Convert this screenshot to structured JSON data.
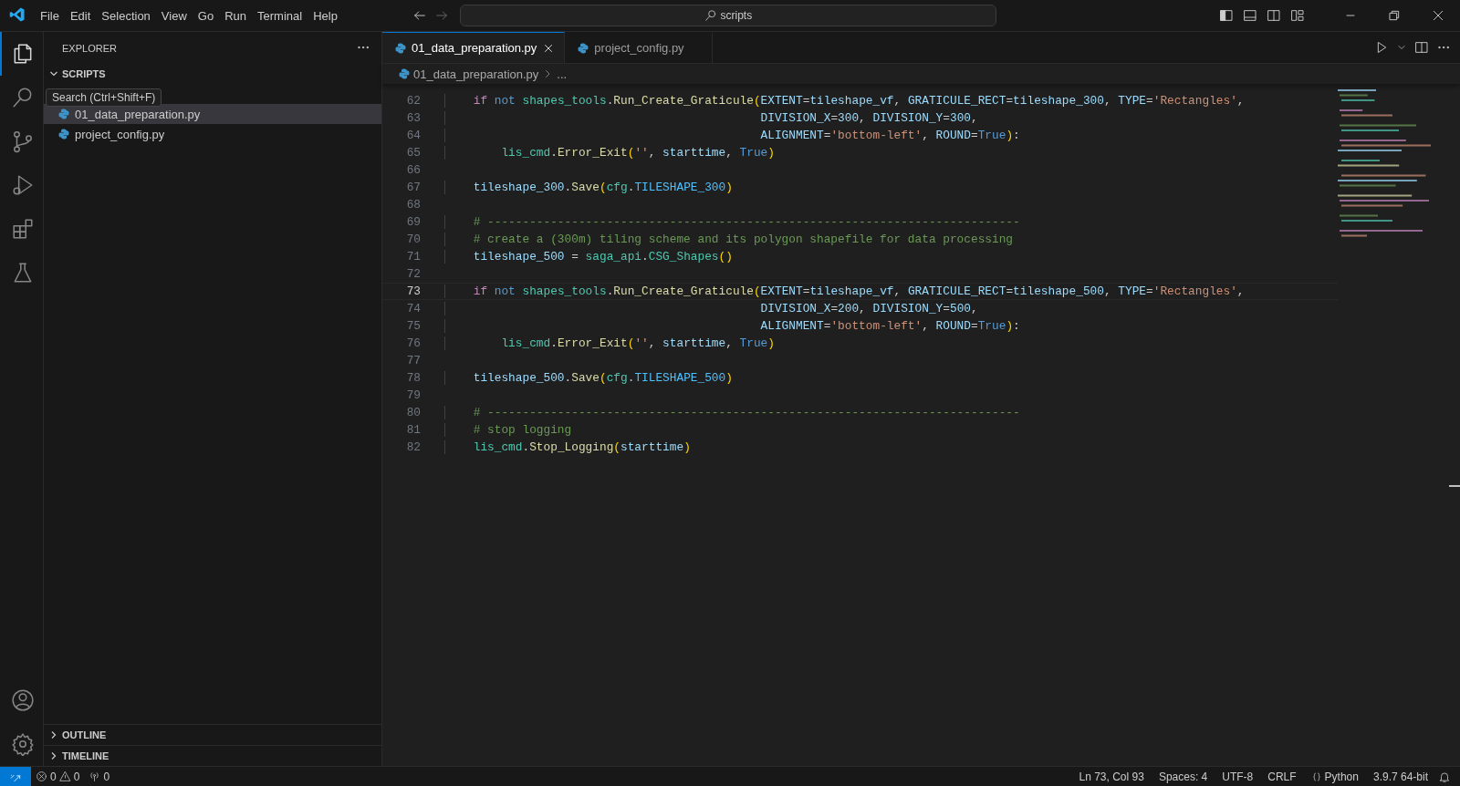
{
  "title_bar": {
    "menus": [
      "File",
      "Edit",
      "Selection",
      "View",
      "Go",
      "Run",
      "Terminal",
      "Help"
    ],
    "search": {
      "value": "scripts"
    }
  },
  "activity_bar": {
    "items": [
      {
        "kind": "files",
        "selected": true
      },
      {
        "kind": "search",
        "selected": false
      },
      {
        "kind": "branch",
        "selected": false
      },
      {
        "kind": "debug",
        "selected": false
      },
      {
        "kind": "extensions",
        "selected": false
      },
      {
        "kind": "flask",
        "selected": false
      }
    ],
    "bottom": [
      {
        "kind": "account"
      },
      {
        "kind": "settings"
      }
    ]
  },
  "sidebar": {
    "title": "EXPLORER",
    "sections": [
      {
        "label": "SCRIPTS",
        "expanded": true,
        "files": [
          {
            "label": "01_data_preparation.py",
            "selected": true
          },
          {
            "label": "project_config.py",
            "selected": false
          }
        ]
      },
      {
        "label": "OUTLINE",
        "expanded": false
      },
      {
        "label": "TIMELINE",
        "expanded": false
      }
    ]
  },
  "tooltip": {
    "text": "Search (Ctrl+Shift+F)"
  },
  "editor": {
    "tabs": [
      {
        "label": "01_data_preparation.py",
        "selected": true
      },
      {
        "label": "project_config.py",
        "selected": false
      }
    ],
    "breadcrumb": [
      "01_data_preparation.py",
      "..."
    ],
    "lines": [
      {
        "number": "62",
        "current": false,
        "tokens": [
          {
            "kind": "kw",
            "text": "    if "
          },
          {
            "kind": "kw2",
            "text": "not "
          },
          {
            "kind": "cls",
            "text": "shapes_tools"
          },
          {
            "kind": "op",
            "text": "."
          },
          {
            "kind": "fn",
            "text": "Run_Create_Graticule"
          },
          {
            "kind": "par",
            "text": "("
          },
          {
            "kind": "var",
            "text": "EXTENT"
          },
          {
            "kind": "op",
            "text": "="
          },
          {
            "kind": "var",
            "text": "tileshape_vf"
          },
          {
            "kind": "op",
            "text": ", "
          },
          {
            "kind": "var",
            "text": "GRATICULE_RECT"
          },
          {
            "kind": "op",
            "text": "="
          },
          {
            "kind": "var",
            "text": "tileshape_300"
          },
          {
            "kind": "op",
            "text": ", "
          },
          {
            "kind": "var",
            "text": "TYPE"
          },
          {
            "kind": "op",
            "text": "="
          },
          {
            "kind": "str",
            "text": "'Rectangles'"
          },
          {
            "kind": "op",
            "text": ","
          }
        ]
      },
      {
        "number": "63",
        "current": false,
        "tokens": [
          {
            "kind": "var",
            "text": "                                             DIVISION_X"
          },
          {
            "kind": "op",
            "text": "="
          },
          {
            "kind": "var",
            "text": "300"
          },
          {
            "kind": "op",
            "text": ", "
          },
          {
            "kind": "var",
            "text": "DIVISION_Y"
          },
          {
            "kind": "op",
            "text": "="
          },
          {
            "kind": "var",
            "text": "300"
          },
          {
            "kind": "op",
            "text": ","
          }
        ]
      },
      {
        "number": "64",
        "current": false,
        "tokens": [
          {
            "kind": "var",
            "text": "                                             ALIGNMENT"
          },
          {
            "kind": "op",
            "text": "="
          },
          {
            "kind": "str",
            "text": "'bottom-left'"
          },
          {
            "kind": "op",
            "text": ", "
          },
          {
            "kind": "var",
            "text": "ROUND"
          },
          {
            "kind": "op",
            "text": "="
          },
          {
            "kind": "kw2",
            "text": "True"
          },
          {
            "kind": "par",
            "text": ")"
          },
          {
            "kind": "op",
            "text": ":"
          }
        ]
      },
      {
        "number": "65",
        "current": false,
        "tokens": [
          {
            "kind": "cls",
            "text": "        lis_cmd"
          },
          {
            "kind": "op",
            "text": "."
          },
          {
            "kind": "fn",
            "text": "Error_Exit"
          },
          {
            "kind": "par",
            "text": "("
          },
          {
            "kind": "str",
            "text": "''"
          },
          {
            "kind": "op",
            "text": ", "
          },
          {
            "kind": "var",
            "text": "starttime"
          },
          {
            "kind": "op",
            "text": ", "
          },
          {
            "kind": "kw2",
            "text": "True"
          },
          {
            "kind": "par",
            "text": ")"
          }
        ]
      },
      {
        "number": "66",
        "current": false
      },
      {
        "number": "67",
        "current": false,
        "tokens": [
          {
            "kind": "var",
            "text": "    tileshape_300"
          },
          {
            "kind": "op",
            "text": "."
          },
          {
            "kind": "fn",
            "text": "Save"
          },
          {
            "kind": "par",
            "text": "("
          },
          {
            "kind": "cls",
            "text": "cfg"
          },
          {
            "kind": "op",
            "text": "."
          },
          {
            "kind": "const",
            "text": "TILESHAPE_300"
          },
          {
            "kind": "par",
            "text": ")"
          }
        ]
      },
      {
        "number": "68",
        "current": false
      },
      {
        "number": "69",
        "current": false,
        "tokens": [
          {
            "kind": "cm",
            "text": "    # ----------------------------------------------------------------------------"
          }
        ]
      },
      {
        "number": "70",
        "current": false,
        "tokens": [
          {
            "kind": "cm",
            "text": "    # create a (300m) tiling scheme and its polygon shapefile for data processing"
          }
        ]
      },
      {
        "number": "71",
        "current": false,
        "tokens": [
          {
            "kind": "var",
            "text": "    tileshape_500"
          },
          {
            "kind": "op",
            "text": " = "
          },
          {
            "kind": "cls",
            "text": "saga_api"
          },
          {
            "kind": "op",
            "text": "."
          },
          {
            "kind": "cls",
            "text": "CSG_Shapes"
          },
          {
            "kind": "par",
            "text": "()"
          }
        ]
      },
      {
        "number": "72",
        "current": false
      },
      {
        "number": "73",
        "current": true,
        "tokens": [
          {
            "kind": "kw",
            "text": "    if "
          },
          {
            "kind": "kw2",
            "text": "not "
          },
          {
            "kind": "cls",
            "text": "shapes_tools"
          },
          {
            "kind": "op",
            "text": "."
          },
          {
            "kind": "fn",
            "text": "Run_Create_Graticule"
          },
          {
            "kind": "par",
            "text": "("
          },
          {
            "kind": "var",
            "text": "EXTENT"
          },
          {
            "kind": "op",
            "text": "="
          },
          {
            "kind": "var",
            "text": "tileshape_vf"
          },
          {
            "kind": "op",
            "text": ", "
          },
          {
            "kind": "var",
            "text": "GRATICULE_RECT"
          },
          {
            "kind": "op",
            "text": "="
          },
          {
            "kind": "var",
            "text": "tileshape_500"
          },
          {
            "kind": "op",
            "text": ", "
          },
          {
            "kind": "var",
            "text": "TYPE"
          },
          {
            "kind": "op",
            "text": "="
          },
          {
            "kind": "str",
            "text": "'Rectangles'"
          },
          {
            "kind": "op",
            "text": ","
          }
        ]
      },
      {
        "number": "74",
        "current": false,
        "tokens": [
          {
            "kind": "var",
            "text": "                                             DIVISION_X"
          },
          {
            "kind": "op",
            "text": "="
          },
          {
            "kind": "var",
            "text": "200"
          },
          {
            "kind": "op",
            "text": ", "
          },
          {
            "kind": "var",
            "text": "DIVISION_Y"
          },
          {
            "kind": "op",
            "text": "="
          },
          {
            "kind": "var",
            "text": "500"
          },
          {
            "kind": "op",
            "text": ","
          }
        ]
      },
      {
        "number": "75",
        "current": false,
        "tokens": [
          {
            "kind": "var",
            "text": "                                             ALIGNMENT"
          },
          {
            "kind": "op",
            "text": "="
          },
          {
            "kind": "str",
            "text": "'bottom-left'"
          },
          {
            "kind": "op",
            "text": ", "
          },
          {
            "kind": "var",
            "text": "ROUND"
          },
          {
            "kind": "op",
            "text": "="
          },
          {
            "kind": "kw2",
            "text": "True"
          },
          {
            "kind": "par",
            "text": ")"
          },
          {
            "kind": "op",
            "text": ":"
          }
        ]
      },
      {
        "number": "76",
        "current": false,
        "tokens": [
          {
            "kind": "cls",
            "text": "        lis_cmd"
          },
          {
            "kind": "op",
            "text": "."
          },
          {
            "kind": "fn",
            "text": "Error_Exit"
          },
          {
            "kind": "par",
            "text": "("
          },
          {
            "kind": "str",
            "text": "''"
          },
          {
            "kind": "op",
            "text": ", "
          },
          {
            "kind": "var",
            "text": "starttime"
          },
          {
            "kind": "op",
            "text": ", "
          },
          {
            "kind": "kw2",
            "text": "True"
          },
          {
            "kind": "par",
            "text": ")"
          }
        ]
      },
      {
        "number": "77",
        "current": false
      },
      {
        "number": "78",
        "current": false,
        "tokens": [
          {
            "kind": "var",
            "text": "    tileshape_500"
          },
          {
            "kind": "op",
            "text": "."
          },
          {
            "kind": "fn",
            "text": "Save"
          },
          {
            "kind": "par",
            "text": "("
          },
          {
            "kind": "cls",
            "text": "cfg"
          },
          {
            "kind": "op",
            "text": "."
          },
          {
            "kind": "const",
            "text": "TILESHAPE_500"
          },
          {
            "kind": "par",
            "text": ")"
          }
        ]
      },
      {
        "number": "79",
        "current": false
      },
      {
        "number": "80",
        "current": false,
        "tokens": [
          {
            "kind": "cm",
            "text": "    # ----------------------------------------------------------------------------"
          }
        ]
      },
      {
        "number": "81",
        "current": false,
        "tokens": [
          {
            "kind": "cm",
            "text": "    # stop logging"
          }
        ]
      },
      {
        "number": "82",
        "current": false,
        "tokens": [
          {
            "kind": "cls",
            "text": "    lis_cmd"
          },
          {
            "kind": "op",
            "text": "."
          },
          {
            "kind": "fn",
            "text": "Stop_Logging"
          },
          {
            "kind": "par",
            "text": "("
          },
          {
            "kind": "var",
            "text": "starttime"
          },
          {
            "kind": "par",
            "text": ")"
          }
        ]
      }
    ]
  },
  "status_bar": {
    "errors": "0",
    "warnings": "0",
    "ports": "0",
    "items": [
      {
        "kind": "text",
        "text": "Ln 73, Col 93"
      },
      {
        "kind": "text",
        "text": "Spaces: 4"
      },
      {
        "kind": "text",
        "text": "UTF-8"
      },
      {
        "kind": "text",
        "text": "CRLF"
      },
      {
        "kind": "language",
        "text": "Python"
      },
      {
        "kind": "text",
        "text": "3.9.7 64-bit"
      }
    ]
  }
}
